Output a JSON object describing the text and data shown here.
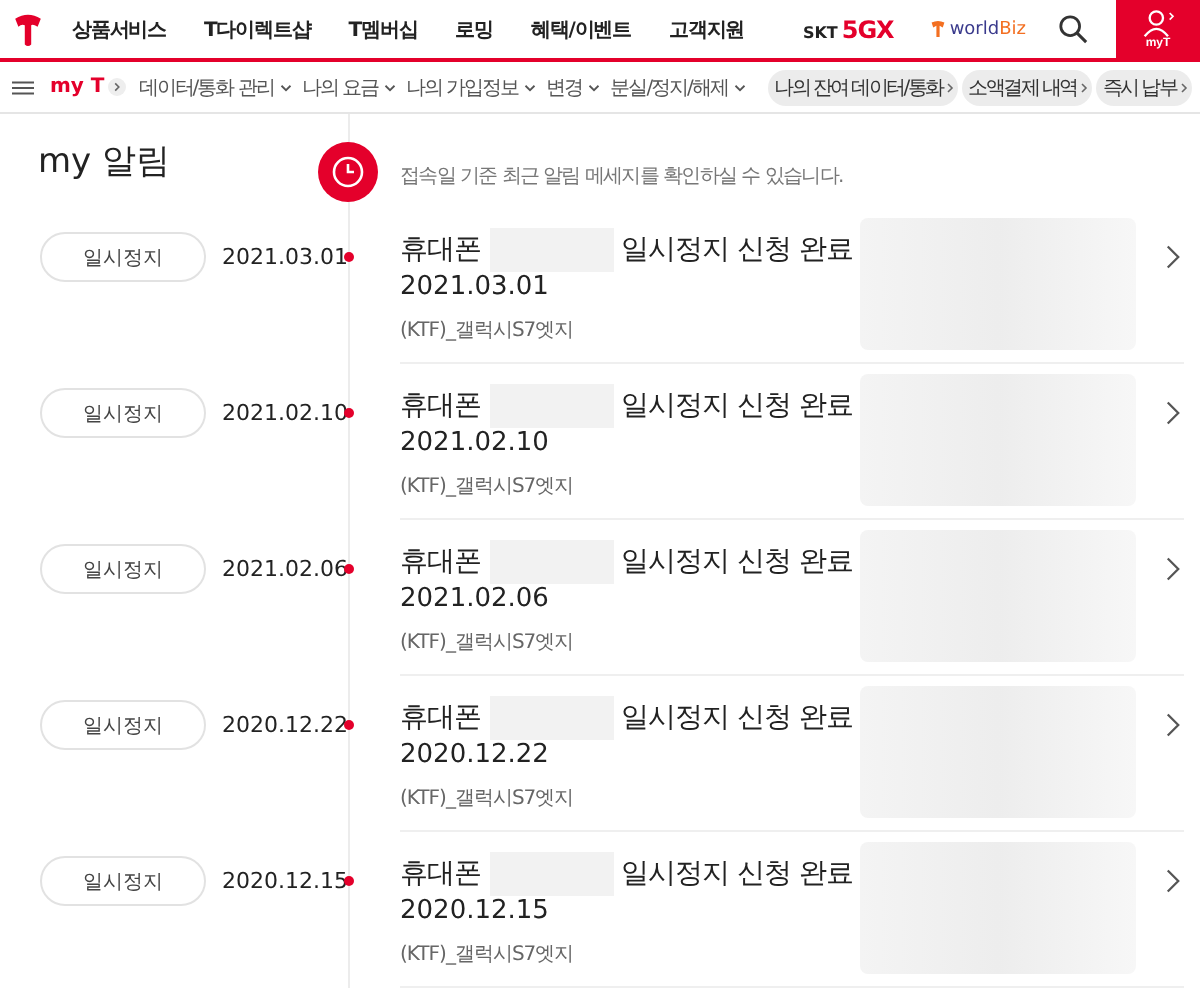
{
  "header": {
    "nav": [
      "상품서비스",
      "T다이렉트샵",
      "T멤버십",
      "로밍",
      "혜택/이벤트",
      "고객지원"
    ],
    "brand_5gx": {
      "prefix": "SKT",
      "mark": "5GX"
    },
    "worldbiz": {
      "prefix": "world",
      "suffix": "Biz"
    },
    "my_button": "myT"
  },
  "subnav": {
    "home": "my T",
    "menus": [
      "데이터/통화 관리",
      "나의 요금",
      "나의 가입정보",
      "변경",
      "분실/정지/해제"
    ],
    "quick_links": [
      "나의 잔여 데이터/통화",
      "소액결제 내역",
      "즉시 납부"
    ]
  },
  "page": {
    "title": "my 알림",
    "notice": "접속일 기준 최근 알림 메세지를 확인하실 수 있습니다."
  },
  "alerts": [
    {
      "tag": "일시정지",
      "date": "2021.03.01",
      "title_prefix": "휴대폰",
      "title_suffix": "일시정지 신청 완료",
      "sub_date": "2021.03.01",
      "device": "(KTF)_갤럭시S7엣지"
    },
    {
      "tag": "일시정지",
      "date": "2021.02.10",
      "title_prefix": "휴대폰",
      "title_suffix": "일시정지 신청 완료",
      "sub_date": "2021.02.10",
      "device": "(KTF)_갤럭시S7엣지"
    },
    {
      "tag": "일시정지",
      "date": "2021.02.06",
      "title_prefix": "휴대폰",
      "title_suffix": "일시정지 신청 완료",
      "sub_date": "2021.02.06",
      "device": "(KTF)_갤럭시S7엣지"
    },
    {
      "tag": "일시정지",
      "date": "2020.12.22",
      "title_prefix": "휴대폰",
      "title_suffix": "일시정지 신청 완료",
      "sub_date": "2020.12.22",
      "device": "(KTF)_갤럭시S7엣지"
    },
    {
      "tag": "일시정지",
      "date": "2020.12.15",
      "title_prefix": "휴대폰",
      "title_suffix": "일시정지 신청 완료",
      "sub_date": "2020.12.15",
      "device": "(KTF)_갤럭시S7엣지"
    }
  ]
}
